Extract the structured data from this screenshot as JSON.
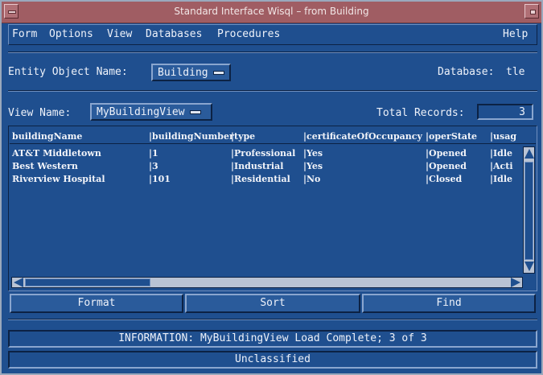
{
  "window": {
    "title": "Standard Interface Wisql – from Building"
  },
  "menu": {
    "form": "Form",
    "options": "Options",
    "view": "View",
    "databases": "Databases",
    "procedures": "Procedures",
    "help": "Help"
  },
  "entity": {
    "label": "Entity Object Name:",
    "value": "Building"
  },
  "database": {
    "label": "Database:",
    "value": "tle"
  },
  "view": {
    "label": "View Name:",
    "value": "MyBuildingView"
  },
  "records": {
    "label": "Total Records:",
    "value": "3"
  },
  "table": {
    "headers": [
      "buildingName",
      "|buildingNumber",
      "|type",
      "|certificateOfOccupancy",
      "|operState",
      "|usag"
    ],
    "rows": [
      [
        "AT&T Middletown",
        "|1",
        "|Professional",
        "|Yes",
        "|Opened",
        "|Idle"
      ],
      [
        "Best Western",
        "|3",
        "|Industrial",
        "|Yes",
        "|Opened",
        "|Acti"
      ],
      [
        "Riverview Hospital",
        "|101",
        "|Residential",
        "|No",
        "|Closed",
        "|Idle"
      ]
    ]
  },
  "buttons": {
    "format": "Format",
    "sort": "Sort",
    "find": "Find"
  },
  "status": {
    "info": "INFORMATION: MyBuildingView Load Complete; 3 of 3",
    "classification": "Unclassified"
  },
  "colors": {
    "window_bg": "#1f4f8f",
    "titlebar_bg": "#a05d63",
    "scroll_trough": "#b9c3d4"
  }
}
